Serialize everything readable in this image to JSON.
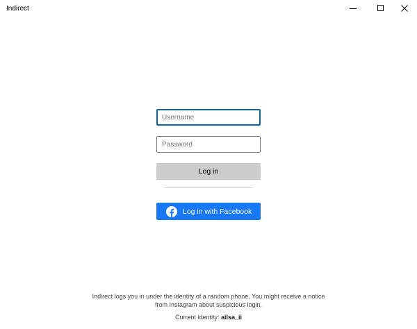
{
  "window": {
    "title": "Indirect"
  },
  "form": {
    "username_placeholder": "Username",
    "password_placeholder": "Password",
    "login_label": "Log in",
    "facebook_label": "Log in with Facebook"
  },
  "footer": {
    "notice_line1": "Indirect logs you in under the identity of a random phone. You might receive a notice",
    "notice_line2": "from Instagram about suspicious login.",
    "identity_prefix": "Current identity: ",
    "identity_name": "ailsa_ii"
  },
  "colors": {
    "facebook_blue": "#1877f2",
    "focus_border": "#0a64b4",
    "button_gray": "#cccccc"
  },
  "icons": {
    "facebook": "facebook-icon",
    "minimize": "minimize-icon",
    "maximize": "maximize-icon",
    "close": "close-icon"
  }
}
